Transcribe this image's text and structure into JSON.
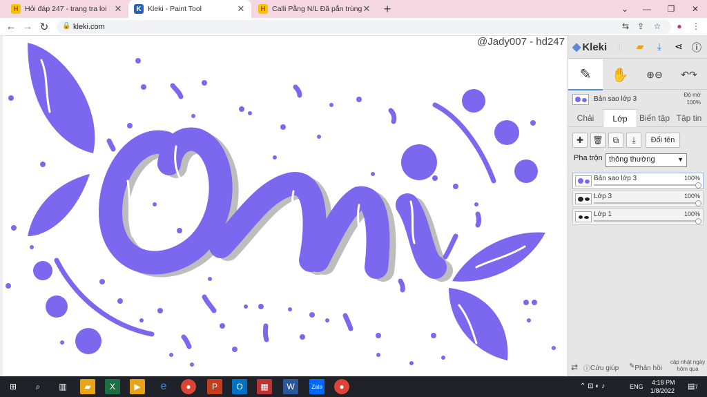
{
  "tabs": [
    {
      "title": "Hỏi đáp 247 - trang tra loi",
      "fav": "H",
      "close": "✕"
    },
    {
      "title": "Kleki - Paint Tool",
      "fav": "K",
      "close": "✕"
    },
    {
      "title": "Calli Pằng N/L Đã pẳn trùng tìm",
      "fav": "H",
      "close": "✕"
    }
  ],
  "new_tab": "+",
  "window": {
    "min": "—",
    "max": "❐",
    "close": "✕",
    "menu": "⌄"
  },
  "nav": {
    "back": "←",
    "forward": "→",
    "reload": "↻"
  },
  "url": "kleki.com",
  "watermark": "@Jady007 - hd247",
  "kleki": {
    "logo": "Kleki",
    "layer_header": {
      "name": "Bản sao lớp 3",
      "opacity_label": "Độ mờ",
      "opacity_value": "100%"
    },
    "panel_tabs": [
      "Chải",
      "Lớp",
      "Biến tập",
      "Tập tin"
    ],
    "rename": "Đổi tên",
    "blend_label": "Pha trộn",
    "blend_value": "thông thường",
    "layers": [
      {
        "name": "Bản sao lớp 3",
        "opacity": "100%"
      },
      {
        "name": "Lớp 3",
        "opacity": "100%"
      },
      {
        "name": "Lớp 1",
        "opacity": "100%"
      }
    ],
    "bottom": {
      "help": "Cứu giúp",
      "feedback": "Phản hồi",
      "update": "cập nhật ngày hôm qua"
    }
  },
  "taskbar": {
    "lang": "ENG",
    "time": "4:18 PM",
    "date": "1/8/2022",
    "notif": "7"
  },
  "colors": {
    "brush": "#7b68ee",
    "shadow": "#bdbdbd",
    "tabbar": "#f5d7e1",
    "taskbar": "#1f2329"
  }
}
